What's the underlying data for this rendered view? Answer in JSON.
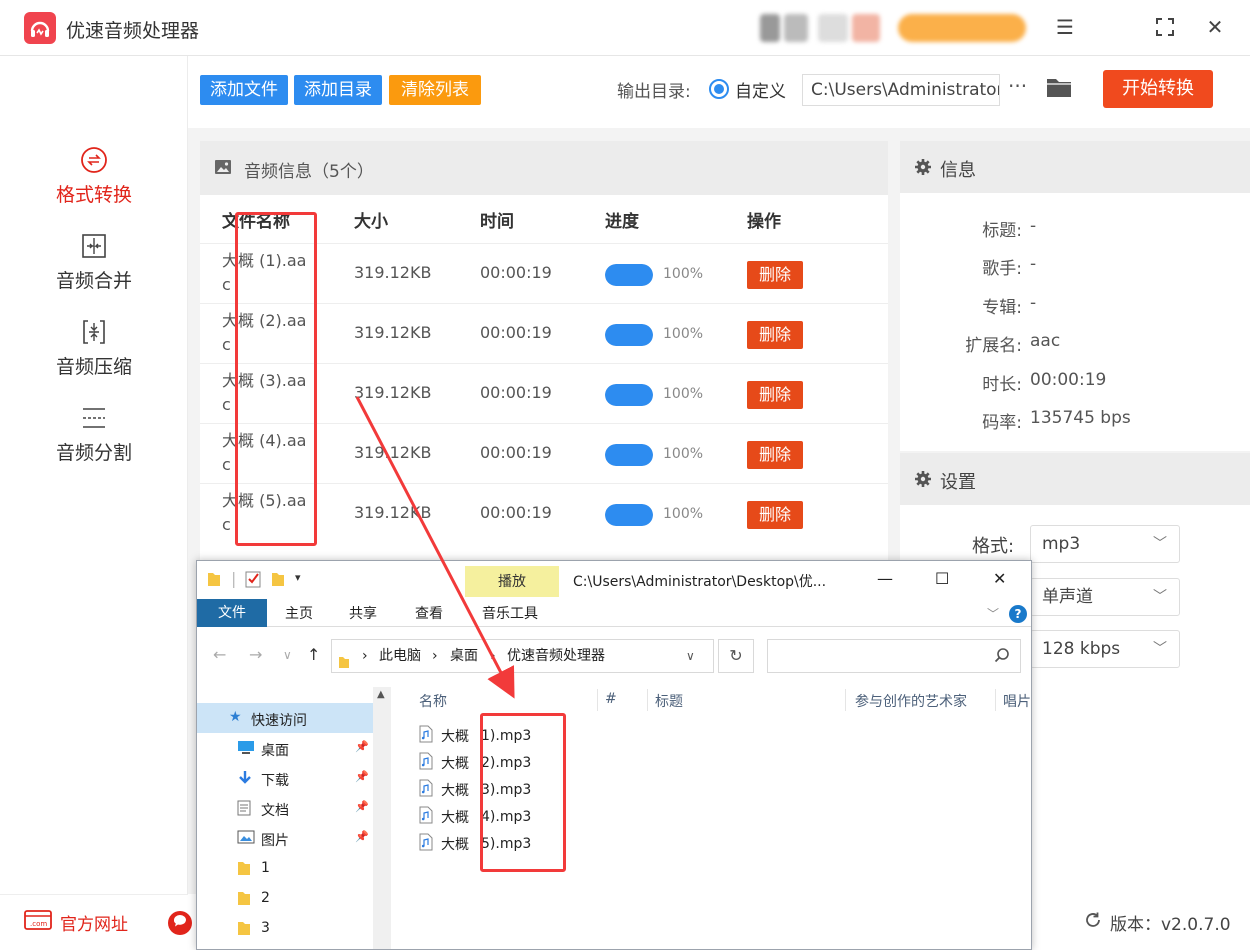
{
  "app": {
    "title": "优速音频处理器"
  },
  "sidebar": {
    "items": [
      {
        "label": "格式转换",
        "icon": "format-convert-icon",
        "active": true
      },
      {
        "label": "音频合并",
        "icon": "merge-icon",
        "active": false
      },
      {
        "label": "音频压缩",
        "icon": "compress-icon",
        "active": false
      },
      {
        "label": "音频分割",
        "icon": "split-icon",
        "active": false
      }
    ],
    "site_label": "官方网址"
  },
  "toolbar": {
    "add_file": "添加文件",
    "add_dir": "添加目录",
    "clear_list": "清除列表",
    "output_label": "输出目录:",
    "radio_custom": "自定义",
    "output_path": "C:\\Users\\Administrator\\",
    "more": "···",
    "start": "开始转换"
  },
  "list": {
    "title": "音频信息（5个）",
    "columns": {
      "name": "文件名称",
      "size": "大小",
      "time": "时间",
      "progress": "进度",
      "action": "操作"
    },
    "rows": [
      {
        "name": "大概 (1).aac",
        "size": "319.12KB",
        "time": "00:00:19",
        "progress": 1.0,
        "pct": "100%",
        "action": "删除"
      },
      {
        "name": "大概 (2).aac",
        "size": "319.12KB",
        "time": "00:00:19",
        "progress": 1.0,
        "pct": "100%",
        "action": "删除"
      },
      {
        "name": "大概 (3).aac",
        "size": "319.12KB",
        "time": "00:00:19",
        "progress": 1.0,
        "pct": "100%",
        "action": "删除"
      },
      {
        "name": "大概 (4).aac",
        "size": "319.12KB",
        "time": "00:00:19",
        "progress": 1.0,
        "pct": "100%",
        "action": "删除"
      },
      {
        "name": "大概 (5).aac",
        "size": "319.12KB",
        "time": "00:00:19",
        "progress": 1.0,
        "pct": "100%",
        "action": "删除"
      }
    ]
  },
  "info": {
    "title": "信息",
    "rows": [
      {
        "key": "标题:",
        "value": "-"
      },
      {
        "key": "歌手:",
        "value": "-"
      },
      {
        "key": "专辑:",
        "value": "-"
      },
      {
        "key": "扩展名:",
        "value": "aac"
      },
      {
        "key": "时长:",
        "value": "00:00:19"
      },
      {
        "key": "码率:",
        "value": "135745 bps"
      }
    ]
  },
  "settings": {
    "title": "设置",
    "format_label": "格式:",
    "format": "mp3",
    "channel": "单声道",
    "bitrate": "128 kbps"
  },
  "footer": {
    "version": "版本：v2.0.7.0"
  },
  "explorer": {
    "play_tab": "播放",
    "path_title": "C:\\Users\\Administrator\\Desktop\\优...",
    "ribbon": {
      "file": "文件",
      "home": "主页",
      "share": "共享",
      "view": "查看",
      "music_tools": "音乐工具"
    },
    "breadcrumb": {
      "pc": "此电脑",
      "desktop": "桌面",
      "folder": "优速音频处理器"
    },
    "tree": [
      {
        "label": "快速访问",
        "icon": "star-icon",
        "pinned": false
      },
      {
        "label": "桌面",
        "icon": "desktop-icon",
        "pinned": true
      },
      {
        "label": "下载",
        "icon": "download-icon",
        "pinned": true
      },
      {
        "label": "文档",
        "icon": "document-icon",
        "pinned": true
      },
      {
        "label": "图片",
        "icon": "picture-icon",
        "pinned": true
      },
      {
        "label": "1",
        "icon": "folder-icon",
        "pinned": false
      },
      {
        "label": "2",
        "icon": "folder-icon",
        "pinned": false
      },
      {
        "label": "3",
        "icon": "folder-icon",
        "pinned": false
      }
    ],
    "columns": {
      "name": "名称",
      "num": "#",
      "title": "标题",
      "artist": "参与创作的艺术家",
      "album": "唱片"
    },
    "files": [
      {
        "prefix": "大概",
        "suffix": "1).mp3"
      },
      {
        "prefix": "大概",
        "suffix": "2).mp3"
      },
      {
        "prefix": "大概",
        "suffix": "3).mp3"
      },
      {
        "prefix": "大概",
        "suffix": "4).mp3"
      },
      {
        "prefix": "大概",
        "suffix": "5).mp3"
      }
    ]
  },
  "colors": {
    "accent_red": "#e1251b",
    "blue": "#2d8cf0",
    "orange": "#fb9a0e",
    "start_btn": "#f04a1e"
  }
}
